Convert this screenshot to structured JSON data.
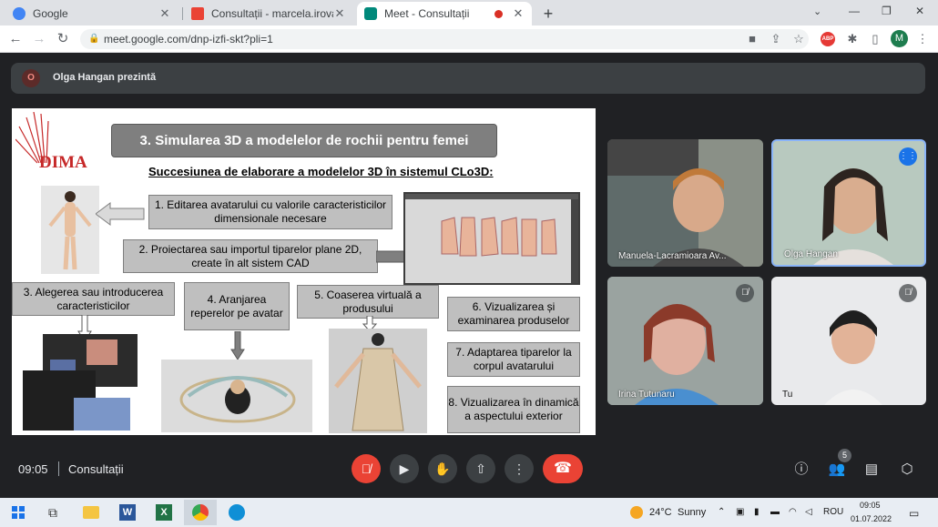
{
  "browser": {
    "tabs": [
      {
        "title": "Google",
        "color": "#4285f4"
      },
      {
        "title": "Consultații - marcela.irovan@gm",
        "color": "#ea4335"
      },
      {
        "title": "Meet - Consultații",
        "color": "#00897b"
      }
    ],
    "new_tab": "+",
    "url": "meet.google.com/dnp-izfi-skt?pli=1",
    "profile_initial": "M",
    "abp_badge": "ABP"
  },
  "meet": {
    "presenter_initial": "O",
    "presenter_label": "Olga Hangan prezintă",
    "time": "09:05",
    "meeting_name": "Consultații",
    "participants_count": "5",
    "tiles": [
      {
        "name": "Manuela-Lacramioara Av..."
      },
      {
        "name": "Olga Hangan"
      },
      {
        "name": "Irina Tutunaru"
      },
      {
        "name": "Tu"
      }
    ]
  },
  "slide": {
    "logo": "DIMA",
    "title": "3. Simularea 3D a modelelor de rochii pentru femei",
    "subtitle": "Succesiunea de elaborare a modelelor 3D în sistemul CLo3D:",
    "steps": [
      "1. Editarea avatarului cu valorile caracteristicilor dimensionale necesare",
      "2. Proiectarea sau importul tiparelor plane 2D, create în alt sistem CAD",
      "3. Alegerea sau introducerea caracteristicilor",
      "4. Aranjarea reperelor pe avatar",
      "5. Coaserea virtuală a produsului",
      "6. Vizualizarea și examinarea produselor",
      "7. Adaptarea tiparelor la corpul avatarului",
      "8. Vizualizarea în dinamică a aspectului exterior"
    ]
  },
  "taskbar": {
    "weather_temp": "24°C",
    "weather_desc": "Sunny",
    "lang": "ROU",
    "clock_time": "09:05",
    "clock_date": "01.07.2022"
  }
}
